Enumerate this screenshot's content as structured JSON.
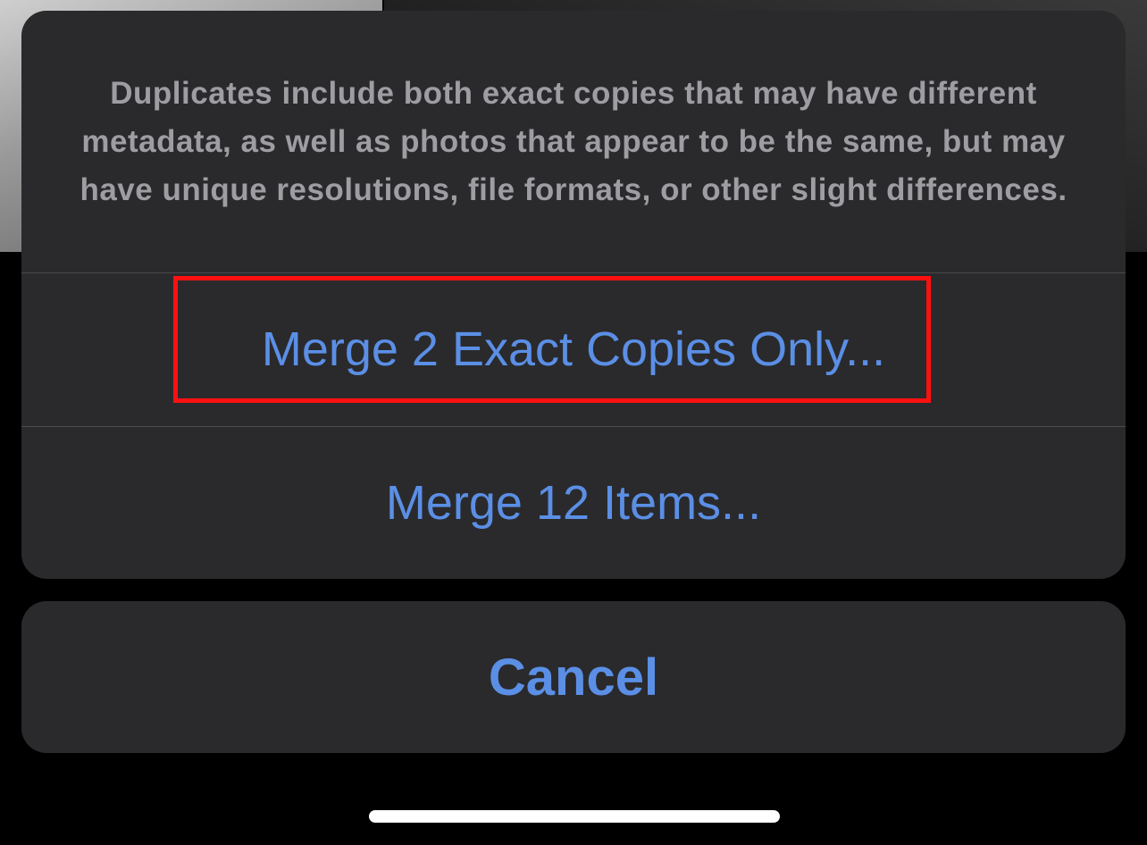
{
  "action_sheet": {
    "message": "Duplicates include both exact copies that may have different metadata, as well as photos that appear to be the same, but may have unique resolutions, file formats, or other slight differences.",
    "actions": [
      {
        "label": "Merge 2 Exact Copies Only..."
      },
      {
        "label": "Merge 12 Items..."
      }
    ],
    "cancel_label": "Cancel"
  },
  "colors": {
    "sheet_background": "#2a2a2c",
    "action_text": "#5b8fe6",
    "message_text": "#9d9da2",
    "highlight_border": "#ff1010"
  }
}
